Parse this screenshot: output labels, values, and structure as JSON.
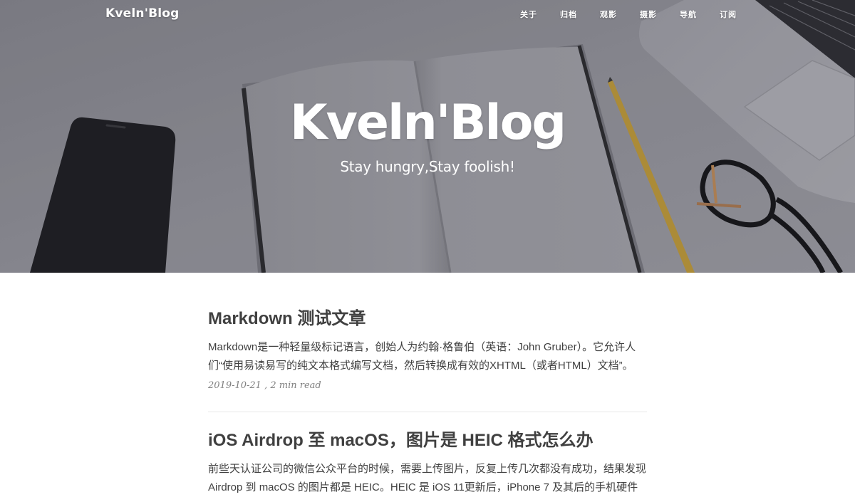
{
  "site": {
    "brand": "Kveln'Blog",
    "nav": [
      {
        "label": "关于"
      },
      {
        "label": "归档"
      },
      {
        "label": "观影"
      },
      {
        "label": "摄影"
      },
      {
        "label": "导航"
      },
      {
        "label": "订阅"
      }
    ]
  },
  "hero": {
    "title": "Kveln'Blog",
    "subtitle": "Stay hungry,Stay foolish!"
  },
  "posts": [
    {
      "title": "Markdown 测试文章",
      "excerpt": "Markdown是一种轻量级标记语言，创始人为约翰·格鲁伯（英语：John Gruber）。它允许人们“使用易读易写的纯文本格式编写文档，然后转换成有效的XHTML（或者HTML）文档”。",
      "meta": "2019-10-21 , 2 min read"
    },
    {
      "title": "iOS Airdrop 至 macOS，图片是 HEIC 格式怎么办",
      "excerpt": "前些天认证公司的微信公众平台的时候，需要上传图片，反复上传几次都没有成功，结果发现 Airdrop 到 macOS 的图片都是 HEIC。HEIC 是 iOS 11更新后，iPhone 7 及其后的手机硬件"
    }
  ],
  "colors": {
    "text": "#404040",
    "meta": "#808080",
    "hero_bg": "#8f8f96"
  },
  "icons": [
    "phone-image",
    "notebook-image",
    "pencil-image",
    "glasses-image",
    "laptop-image"
  ]
}
